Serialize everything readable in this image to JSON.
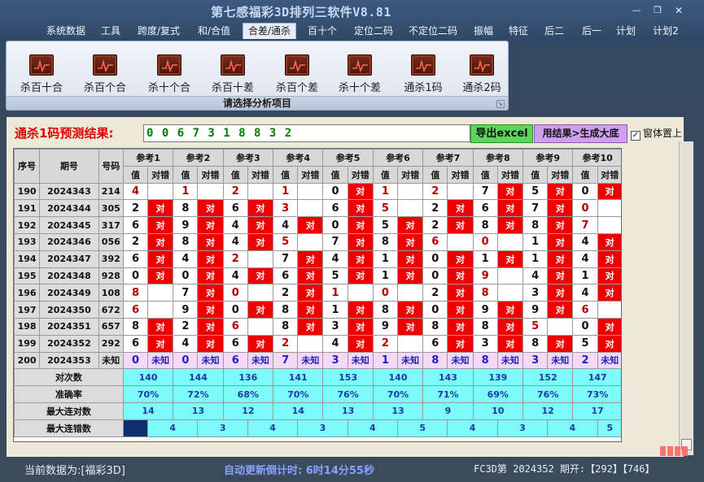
{
  "window": {
    "title": "第七感福彩3D排列三软件V8.81",
    "minimize": "—",
    "restore": "❐",
    "close": "✕"
  },
  "menu": [
    "系统数据",
    "工具",
    "跨度/复式",
    "和/合值",
    "合差/通杀",
    "百十个",
    "定位二码",
    "不定位二码",
    "振幅",
    "特征",
    "后二",
    "后一",
    "计划",
    "计划2"
  ],
  "menu_active_index": 4,
  "ribbon": {
    "buttons": [
      "杀百十合",
      "杀百个合",
      "杀十个合",
      "杀百十差",
      "杀百个差",
      "杀十个差",
      "通杀1码",
      "通杀2码"
    ],
    "footer": "请选择分析项目"
  },
  "prediction": {
    "label": "通杀1码预测结果:",
    "value": "0 0 6 7 3 1 8 8 3 2",
    "export_button": "导出excel",
    "generate_button": "用结果>生成大底",
    "topmost_label": "窗体置上",
    "topmost_checked": true
  },
  "table": {
    "headers": {
      "seq": "序号",
      "period": "期号",
      "number": "号码",
      "value": "值",
      "result": "对错",
      "refs": [
        "参考1",
        "参考2",
        "参考3",
        "参考4",
        "参考5",
        "参考6",
        "参考7",
        "参考8",
        "参考9",
        "参考10"
      ]
    },
    "rows": [
      {
        "seq": "190",
        "period": "2024343",
        "number": "214",
        "cells": [
          [
            "4",
            0
          ],
          [
            "1",
            0
          ],
          [
            "2",
            0
          ],
          [
            "1",
            0
          ],
          [
            "0",
            1
          ],
          [
            "1",
            0
          ],
          [
            "2",
            0
          ],
          [
            "7",
            1
          ],
          [
            "5",
            1
          ],
          [
            "0",
            1
          ]
        ]
      },
      {
        "seq": "191",
        "period": "2024344",
        "number": "305",
        "cells": [
          [
            "2",
            1
          ],
          [
            "8",
            1
          ],
          [
            "6",
            1
          ],
          [
            "3",
            0
          ],
          [
            "6",
            1
          ],
          [
            "5",
            0
          ],
          [
            "2",
            1
          ],
          [
            "6",
            1
          ],
          [
            "7",
            1
          ],
          [
            "0",
            0
          ]
        ]
      },
      {
        "seq": "192",
        "period": "2024345",
        "number": "317",
        "cells": [
          [
            "6",
            1
          ],
          [
            "9",
            1
          ],
          [
            "4",
            1
          ],
          [
            "4",
            1
          ],
          [
            "0",
            1
          ],
          [
            "5",
            1
          ],
          [
            "2",
            1
          ],
          [
            "8",
            1
          ],
          [
            "8",
            1
          ],
          [
            "7",
            0
          ]
        ]
      },
      {
        "seq": "193",
        "period": "2024346",
        "number": "056",
        "cells": [
          [
            "2",
            1
          ],
          [
            "8",
            1
          ],
          [
            "4",
            1
          ],
          [
            "5",
            0
          ],
          [
            "7",
            1
          ],
          [
            "8",
            1
          ],
          [
            "6",
            0
          ],
          [
            "0",
            0
          ],
          [
            "1",
            1
          ],
          [
            "4",
            1
          ]
        ]
      },
      {
        "seq": "194",
        "period": "2024347",
        "number": "392",
        "cells": [
          [
            "6",
            1
          ],
          [
            "4",
            1
          ],
          [
            "2",
            0
          ],
          [
            "7",
            1
          ],
          [
            "4",
            1
          ],
          [
            "1",
            1
          ],
          [
            "0",
            1
          ],
          [
            "1",
            1
          ],
          [
            "1",
            1
          ],
          [
            "4",
            1
          ]
        ]
      },
      {
        "seq": "195",
        "period": "2024348",
        "number": "928",
        "cells": [
          [
            "0",
            1
          ],
          [
            "0",
            1
          ],
          [
            "4",
            1
          ],
          [
            "6",
            1
          ],
          [
            "5",
            1
          ],
          [
            "1",
            1
          ],
          [
            "0",
            1
          ],
          [
            "9",
            0
          ],
          [
            "4",
            1
          ],
          [
            "1",
            1
          ]
        ]
      },
      {
        "seq": "196",
        "period": "2024349",
        "number": "108",
        "cells": [
          [
            "8",
            0
          ],
          [
            "7",
            1
          ],
          [
            "0",
            0
          ],
          [
            "2",
            1
          ],
          [
            "1",
            0
          ],
          [
            "0",
            0
          ],
          [
            "2",
            1
          ],
          [
            "8",
            0
          ],
          [
            "3",
            1
          ],
          [
            "4",
            1
          ]
        ]
      },
      {
        "seq": "197",
        "period": "2024350",
        "number": "672",
        "cells": [
          [
            "6",
            0
          ],
          [
            "9",
            1
          ],
          [
            "0",
            1
          ],
          [
            "8",
            1
          ],
          [
            "1",
            1
          ],
          [
            "8",
            1
          ],
          [
            "0",
            1
          ],
          [
            "9",
            1
          ],
          [
            "9",
            1
          ],
          [
            "6",
            0
          ]
        ]
      },
      {
        "seq": "198",
        "period": "2024351",
        "number": "657",
        "cells": [
          [
            "8",
            1
          ],
          [
            "2",
            1
          ],
          [
            "6",
            0
          ],
          [
            "8",
            1
          ],
          [
            "3",
            1
          ],
          [
            "9",
            1
          ],
          [
            "8",
            1
          ],
          [
            "8",
            1
          ],
          [
            "5",
            0
          ],
          [
            "0",
            1
          ]
        ]
      },
      {
        "seq": "199",
        "period": "2024352",
        "number": "292",
        "cells": [
          [
            "6",
            1
          ],
          [
            "4",
            1
          ],
          [
            "6",
            1
          ],
          [
            "2",
            0
          ],
          [
            "4",
            1
          ],
          [
            "2",
            0
          ],
          [
            "6",
            1
          ],
          [
            "3",
            1
          ],
          [
            "8",
            1
          ],
          [
            "5",
            1
          ]
        ]
      }
    ],
    "pending_row": {
      "seq": "200",
      "period": "2024353",
      "number": "未知",
      "values": [
        "0",
        "0",
        "6",
        "7",
        "3",
        "1",
        "8",
        "8",
        "3",
        "2"
      ],
      "status": "未知"
    },
    "result_mark": "对",
    "stats": [
      {
        "label": "对次数",
        "values": [
          "140",
          "144",
          "136",
          "141",
          "153",
          "140",
          "143",
          "139",
          "152",
          "147"
        ]
      },
      {
        "label": "准确率",
        "values": [
          "70%",
          "72%",
          "68%",
          "70%",
          "76%",
          "70%",
          "71%",
          "69%",
          "76%",
          "73%"
        ]
      },
      {
        "label": "最大连对数",
        "values": [
          "14",
          "13",
          "12",
          "14",
          "13",
          "13",
          "9",
          "10",
          "12",
          "17"
        ]
      },
      {
        "label": "最大连错数",
        "values": [
          "4",
          "3",
          "4",
          "3",
          "4",
          "5",
          "4",
          "3",
          "4",
          "5"
        ]
      }
    ]
  },
  "status": {
    "current_data": "当前数据为:[福彩3D]",
    "countdown": "自动更新倒计时:  6时14分55秒",
    "latest": "FC3D第 2024352 期开:【292】【746】"
  },
  "colors": {
    "accent_red": "#ee0000",
    "stat_cyan": "#7dfbfb",
    "pending_pink": "#f8d8f8",
    "export_green": "#5bd65b",
    "gen_purple": "#cfa0f0"
  }
}
